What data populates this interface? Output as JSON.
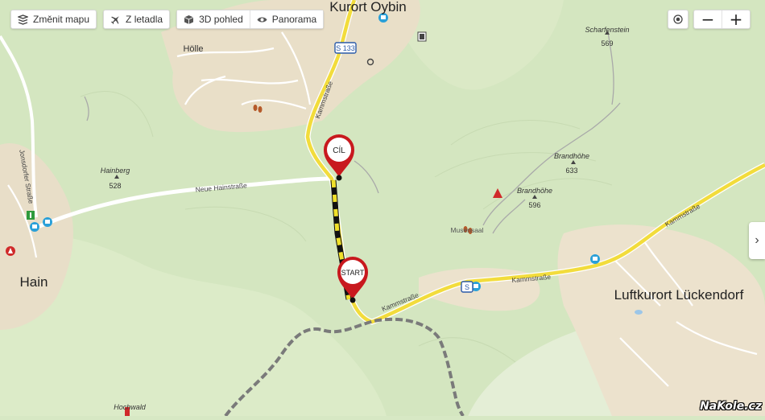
{
  "toolbar": {
    "change_map": "Změnit mapu",
    "from_plane": "Z letadla",
    "view_3d": "3D pohled",
    "panorama": "Panorama"
  },
  "zoom": {
    "minus": "−",
    "plus": "+"
  },
  "side_tab": "›",
  "markers": {
    "finish": "CÍL",
    "start": "START"
  },
  "places": {
    "kurort_oybin": "Kurort Oybin",
    "hain": "Hain",
    "luckendorf": "Luftkurort Lückendorf",
    "holle": "Hölle"
  },
  "peaks": {
    "scharfenstein": {
      "name": "Scharfenstein",
      "elevation": "569"
    },
    "brandhohe_1": {
      "name": "Brandhöhe",
      "elevation": "633"
    },
    "brandhohe_2": {
      "name": "Brandhöhe",
      "elevation": "596"
    },
    "hainberg": {
      "name": "Hainberg",
      "elevation": "528"
    },
    "hochwald": {
      "name": "Hochwald"
    }
  },
  "streets": {
    "neue_hainstrasse": "Neue Hainstraße",
    "kammstrasse_1": "Kammstraße",
    "kammstrasse_2": "Kammstraße",
    "kammstrasse_3": "Kammstraße",
    "kammstrasse_4": "Kammstraße",
    "jonsdorfer_strasse": "Jonsdorfer Straße"
  },
  "road_shields": {
    "s133": "S 133",
    "s": "S"
  },
  "poi": {
    "musensaal": "Musensaal"
  },
  "watermark": "NaKole.cz",
  "colors": {
    "forest": "#d7e8c4",
    "meadow": "#e8f0d8",
    "settlement": "#e9dfc9",
    "road_major": "#f2dc3c",
    "route": "#e8d21c",
    "border": "#666666",
    "marker": "#c8191e"
  }
}
